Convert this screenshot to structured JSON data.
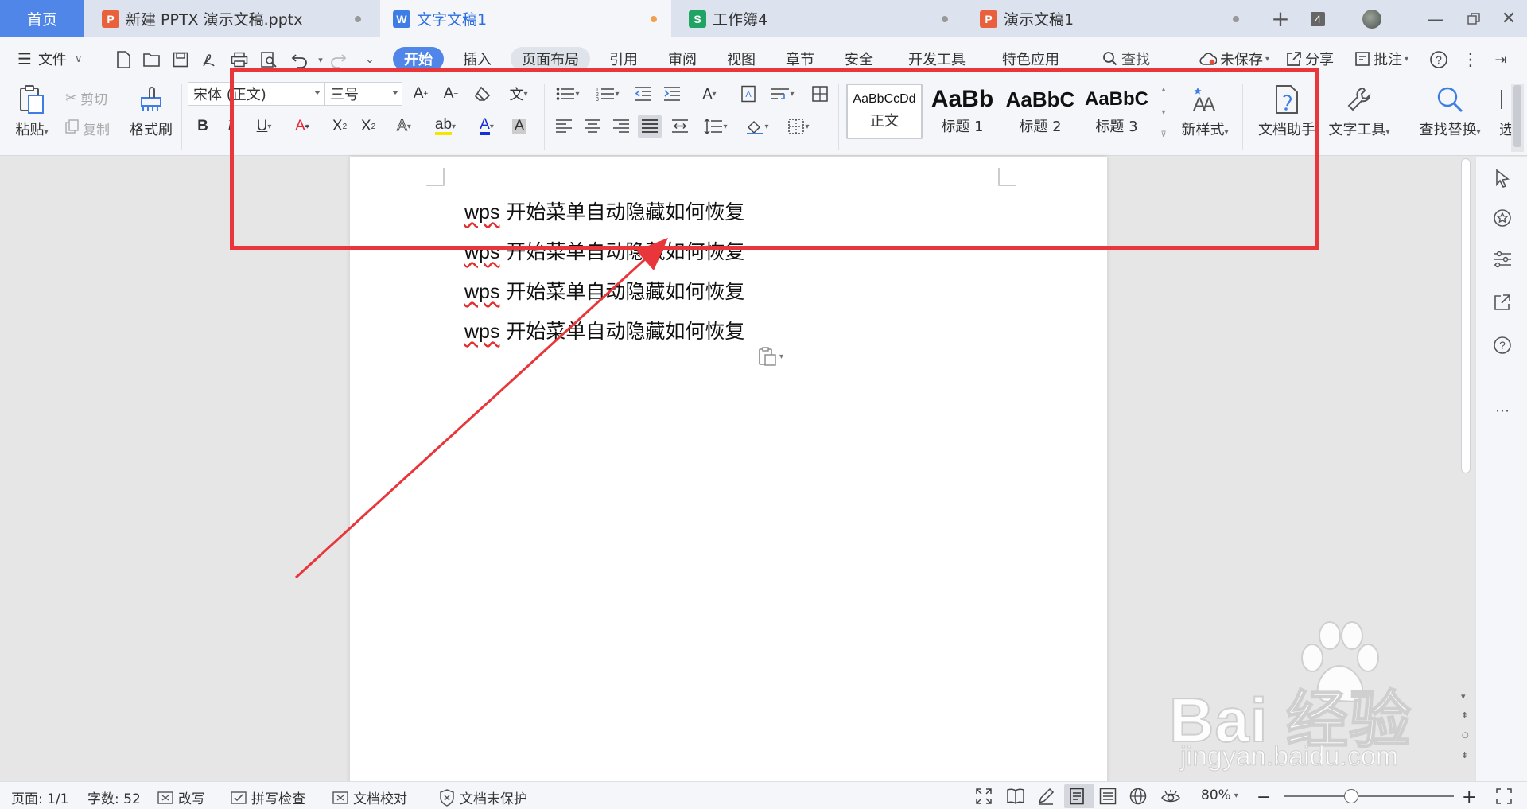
{
  "tabs": [
    {
      "label": "首页",
      "type": "home"
    },
    {
      "label": "新建 PPTX 演示文稿.pptx",
      "icon": "P",
      "icon_color": "#e8613c"
    },
    {
      "label": "文字文稿1",
      "icon": "W",
      "icon_color": "#3d7de4",
      "active": true
    },
    {
      "label": "工作簿4",
      "icon": "S",
      "icon_color": "#1fa463"
    },
    {
      "label": "演示文稿1",
      "icon": "P",
      "icon_color": "#e8613c"
    }
  ],
  "window": {
    "tab_count": "4"
  },
  "menu": {
    "file": "文件",
    "items": [
      "开始",
      "插入",
      "页面布局",
      "引用",
      "审阅",
      "视图",
      "章节",
      "安全",
      "开发工具",
      "特色应用"
    ],
    "search": "查找",
    "unsaved": "未保存",
    "share": "分享",
    "comment": "批注"
  },
  "ribbon": {
    "paste": "粘贴",
    "cut": "剪切",
    "copy": "复制",
    "format_painter": "格式刷",
    "font_name": "宋体 (正文)",
    "font_size": "三号",
    "styles": [
      {
        "sample": "AaBbCcDd",
        "label": "正文"
      },
      {
        "sample": "AaBb",
        "label": "标题 1"
      },
      {
        "sample": "AaBbC",
        "label": "标题 2"
      },
      {
        "sample": "AaBbC",
        "label": "标题 3"
      }
    ],
    "new_style": "新样式",
    "doc_assistant": "文档助手",
    "text_tools": "文字工具",
    "find_replace": "查找替换",
    "select": "选"
  },
  "document": {
    "lines": [
      {
        "wps": "wps",
        "rest": " 开始菜单自动隐藏如何恢复"
      },
      {
        "wps": "wps",
        "rest": " 开始菜单自动隐藏如何恢复"
      },
      {
        "wps": "wps",
        "rest": " 开始菜单自动隐藏如何恢复"
      },
      {
        "wps": "wps",
        "rest": " 开始菜单自动隐藏如何恢复"
      }
    ]
  },
  "status": {
    "page": "页面: 1/1",
    "word_count": "字数: 52",
    "overwrite": "改写",
    "spell_check": "拼写检查",
    "proofread": "文档校对",
    "protection": "文档未保护",
    "zoom": "80%"
  },
  "annotation": {
    "color": "#e8363a"
  },
  "watermark": {
    "brand": "Bai 经验",
    "url": "jingyan.baidu.com"
  },
  "colors": {
    "accent": "#4f86e8",
    "tabbar": "#dde3ee",
    "ribbon": "#f4f6f9"
  }
}
